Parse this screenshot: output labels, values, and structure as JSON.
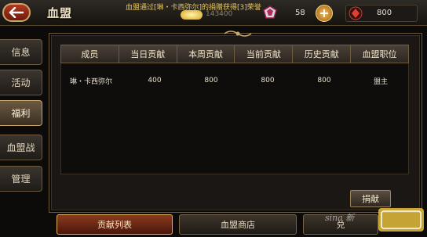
{
  "header": {
    "title": "血盟",
    "ticker": "血盟通过[琳・卡西弥尔]的捐赠获得[3]荣誉",
    "gold_value": "143400",
    "gem_value": "58",
    "coin_value": "800"
  },
  "sidebar": {
    "items": [
      {
        "label": "信息",
        "active": false
      },
      {
        "label": "活动",
        "active": false
      },
      {
        "label": "福利",
        "active": true
      },
      {
        "label": "血盟战",
        "active": false
      },
      {
        "label": "管理",
        "active": false
      }
    ]
  },
  "table": {
    "columns": [
      "成员",
      "当日贡献",
      "本周贡献",
      "当前贡献",
      "历史贡献",
      "血盟职位"
    ],
    "rows": [
      [
        "琳・卡西弥尔",
        "400",
        "800",
        "800",
        "800",
        "盟主"
      ]
    ]
  },
  "actions": {
    "donate_label": "捐献"
  },
  "bottom_tabs": [
    {
      "label": "贡献列表",
      "active": true
    },
    {
      "label": "血盟商店",
      "active": false
    },
    {
      "label": "兑",
      "active": false
    }
  ],
  "watermark": {
    "text": "sina 新"
  },
  "colors": {
    "accent_gold": "#c9a66b",
    "active_tab": "#8a3a20",
    "panel_bg": "#1a1714"
  }
}
